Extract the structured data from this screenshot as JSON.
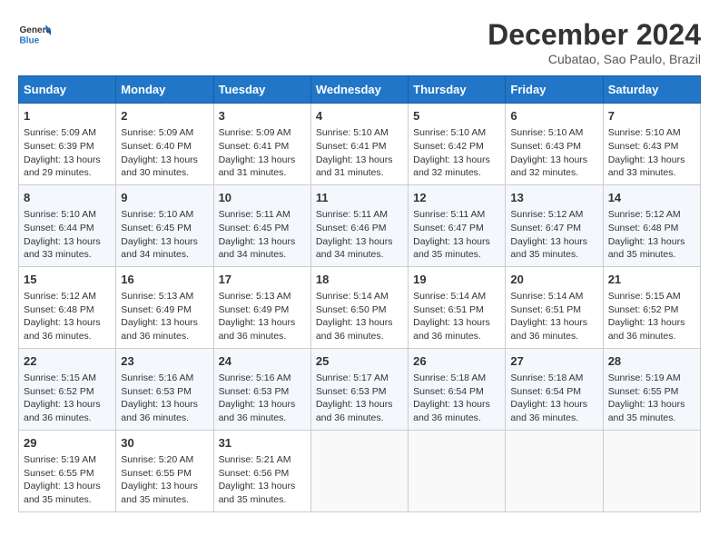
{
  "logo": {
    "line1": "General",
    "line2": "Blue"
  },
  "title": "December 2024",
  "subtitle": "Cubatao, Sao Paulo, Brazil",
  "days_of_week": [
    "Sunday",
    "Monday",
    "Tuesday",
    "Wednesday",
    "Thursday",
    "Friday",
    "Saturday"
  ],
  "weeks": [
    [
      {
        "day": 1,
        "sunrise": "5:09 AM",
        "sunset": "6:39 PM",
        "daylight": "13 hours and 29 minutes."
      },
      {
        "day": 2,
        "sunrise": "5:09 AM",
        "sunset": "6:40 PM",
        "daylight": "13 hours and 30 minutes."
      },
      {
        "day": 3,
        "sunrise": "5:09 AM",
        "sunset": "6:41 PM",
        "daylight": "13 hours and 31 minutes."
      },
      {
        "day": 4,
        "sunrise": "5:10 AM",
        "sunset": "6:41 PM",
        "daylight": "13 hours and 31 minutes."
      },
      {
        "day": 5,
        "sunrise": "5:10 AM",
        "sunset": "6:42 PM",
        "daylight": "13 hours and 32 minutes."
      },
      {
        "day": 6,
        "sunrise": "5:10 AM",
        "sunset": "6:43 PM",
        "daylight": "13 hours and 32 minutes."
      },
      {
        "day": 7,
        "sunrise": "5:10 AM",
        "sunset": "6:43 PM",
        "daylight": "13 hours and 33 minutes."
      }
    ],
    [
      {
        "day": 8,
        "sunrise": "5:10 AM",
        "sunset": "6:44 PM",
        "daylight": "13 hours and 33 minutes."
      },
      {
        "day": 9,
        "sunrise": "5:10 AM",
        "sunset": "6:45 PM",
        "daylight": "13 hours and 34 minutes."
      },
      {
        "day": 10,
        "sunrise": "5:11 AM",
        "sunset": "6:45 PM",
        "daylight": "13 hours and 34 minutes."
      },
      {
        "day": 11,
        "sunrise": "5:11 AM",
        "sunset": "6:46 PM",
        "daylight": "13 hours and 34 minutes."
      },
      {
        "day": 12,
        "sunrise": "5:11 AM",
        "sunset": "6:47 PM",
        "daylight": "13 hours and 35 minutes."
      },
      {
        "day": 13,
        "sunrise": "5:12 AM",
        "sunset": "6:47 PM",
        "daylight": "13 hours and 35 minutes."
      },
      {
        "day": 14,
        "sunrise": "5:12 AM",
        "sunset": "6:48 PM",
        "daylight": "13 hours and 35 minutes."
      }
    ],
    [
      {
        "day": 15,
        "sunrise": "5:12 AM",
        "sunset": "6:48 PM",
        "daylight": "13 hours and 36 minutes."
      },
      {
        "day": 16,
        "sunrise": "5:13 AM",
        "sunset": "6:49 PM",
        "daylight": "13 hours and 36 minutes."
      },
      {
        "day": 17,
        "sunrise": "5:13 AM",
        "sunset": "6:49 PM",
        "daylight": "13 hours and 36 minutes."
      },
      {
        "day": 18,
        "sunrise": "5:14 AM",
        "sunset": "6:50 PM",
        "daylight": "13 hours and 36 minutes."
      },
      {
        "day": 19,
        "sunrise": "5:14 AM",
        "sunset": "6:51 PM",
        "daylight": "13 hours and 36 minutes."
      },
      {
        "day": 20,
        "sunrise": "5:14 AM",
        "sunset": "6:51 PM",
        "daylight": "13 hours and 36 minutes."
      },
      {
        "day": 21,
        "sunrise": "5:15 AM",
        "sunset": "6:52 PM",
        "daylight": "13 hours and 36 minutes."
      }
    ],
    [
      {
        "day": 22,
        "sunrise": "5:15 AM",
        "sunset": "6:52 PM",
        "daylight": "13 hours and 36 minutes."
      },
      {
        "day": 23,
        "sunrise": "5:16 AM",
        "sunset": "6:53 PM",
        "daylight": "13 hours and 36 minutes."
      },
      {
        "day": 24,
        "sunrise": "5:16 AM",
        "sunset": "6:53 PM",
        "daylight": "13 hours and 36 minutes."
      },
      {
        "day": 25,
        "sunrise": "5:17 AM",
        "sunset": "6:53 PM",
        "daylight": "13 hours and 36 minutes."
      },
      {
        "day": 26,
        "sunrise": "5:18 AM",
        "sunset": "6:54 PM",
        "daylight": "13 hours and 36 minutes."
      },
      {
        "day": 27,
        "sunrise": "5:18 AM",
        "sunset": "6:54 PM",
        "daylight": "13 hours and 36 minutes."
      },
      {
        "day": 28,
        "sunrise": "5:19 AM",
        "sunset": "6:55 PM",
        "daylight": "13 hours and 35 minutes."
      }
    ],
    [
      {
        "day": 29,
        "sunrise": "5:19 AM",
        "sunset": "6:55 PM",
        "daylight": "13 hours and 35 minutes."
      },
      {
        "day": 30,
        "sunrise": "5:20 AM",
        "sunset": "6:55 PM",
        "daylight": "13 hours and 35 minutes."
      },
      {
        "day": 31,
        "sunrise": "5:21 AM",
        "sunset": "6:56 PM",
        "daylight": "13 hours and 35 minutes."
      },
      null,
      null,
      null,
      null
    ]
  ]
}
